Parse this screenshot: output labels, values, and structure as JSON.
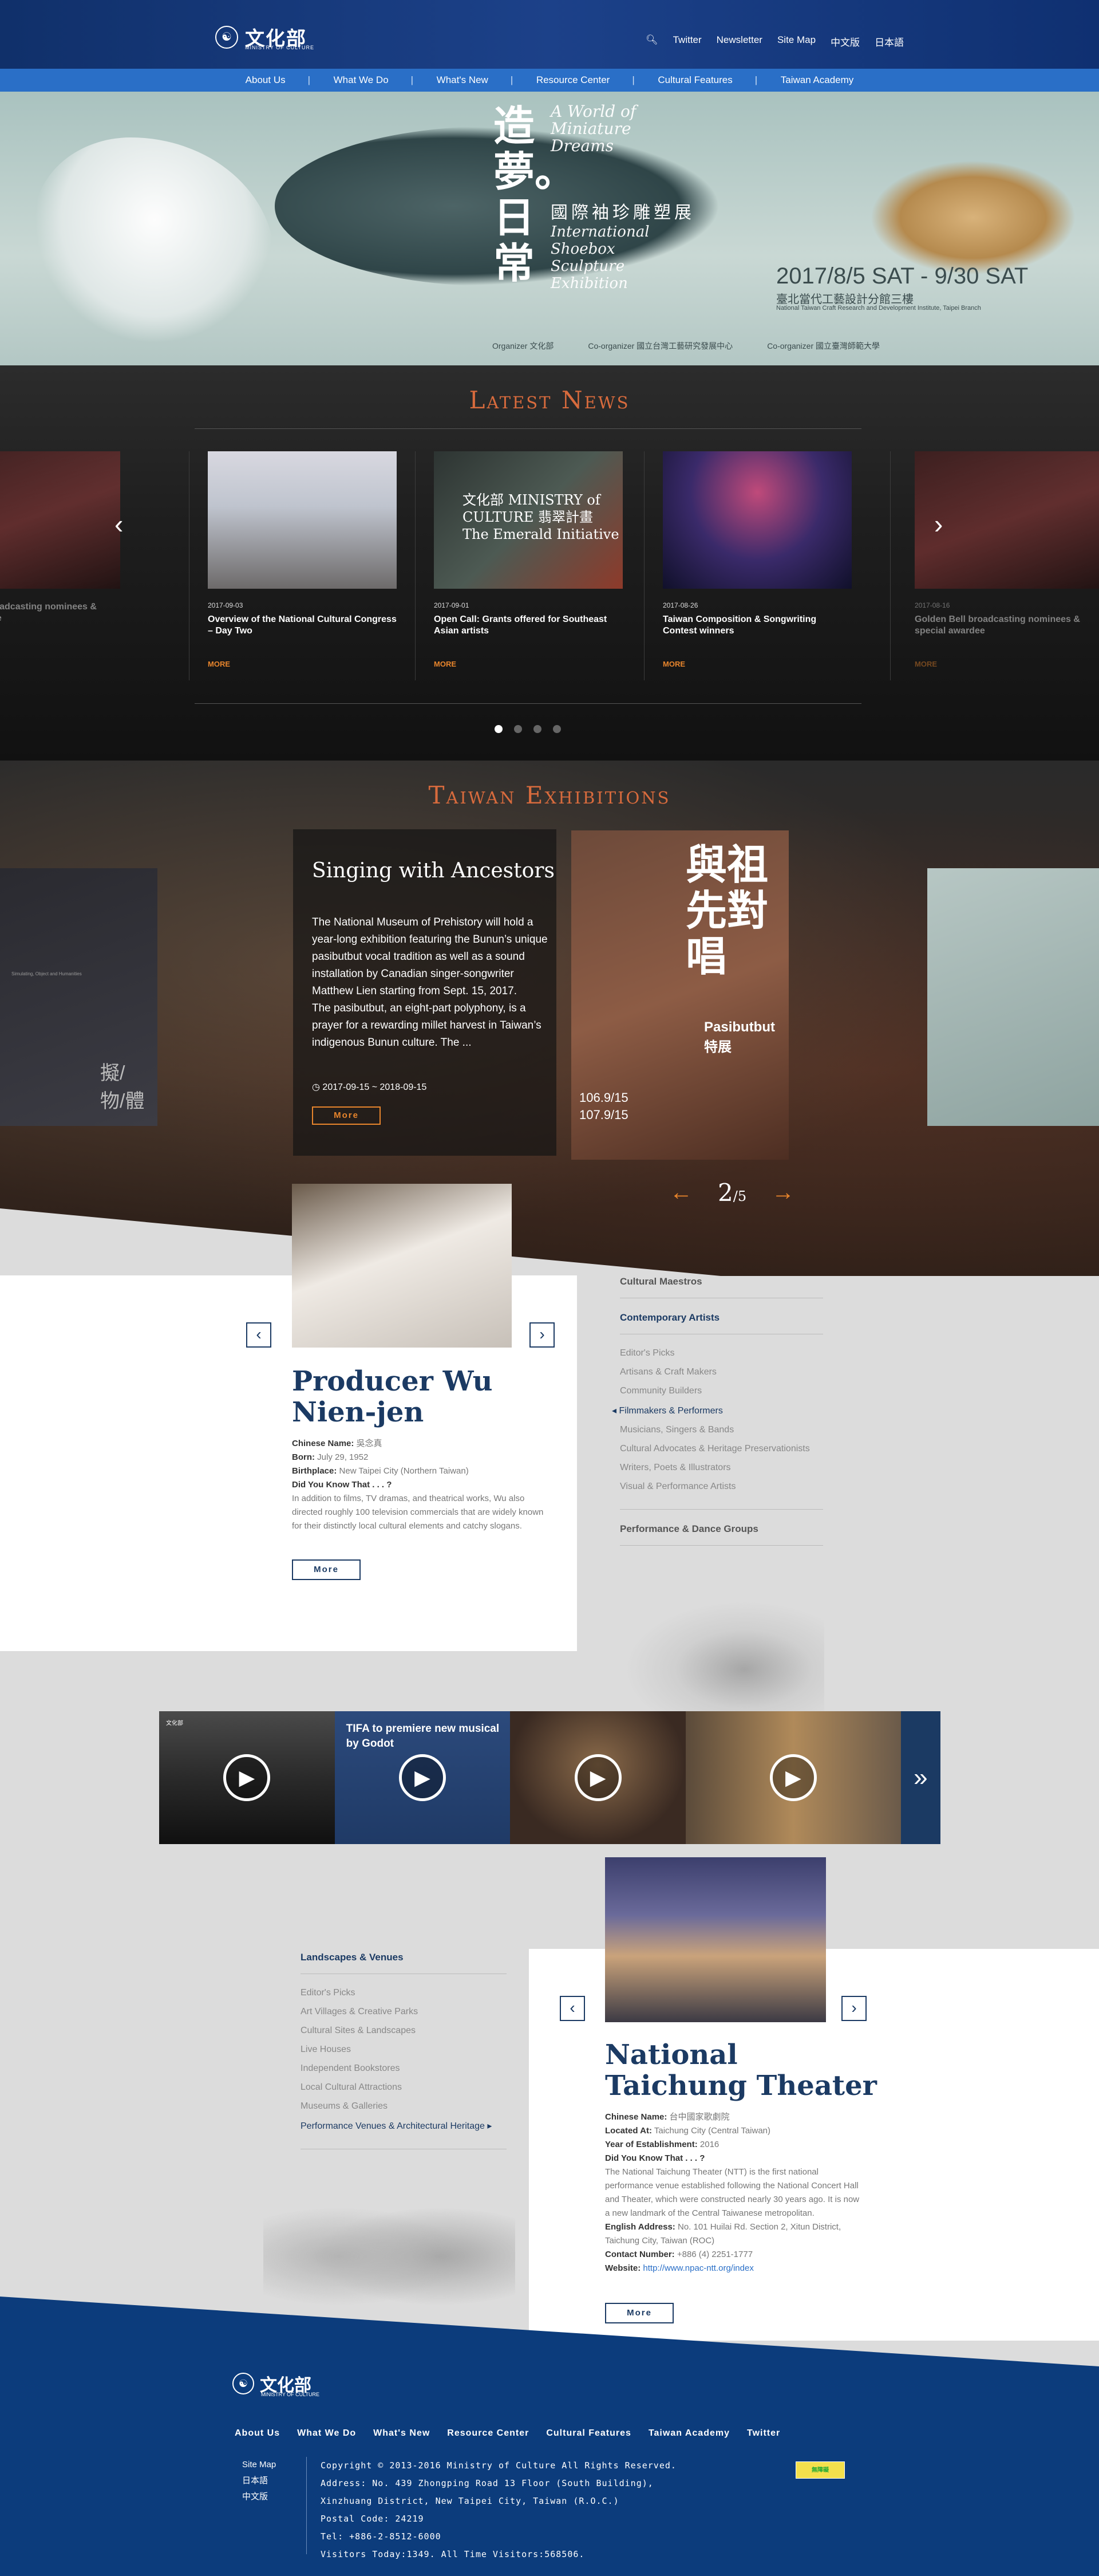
{
  "header": {
    "logo_cn": "文化部",
    "logo_en": "MINISTRY OF CULTURE",
    "top_menu": [
      "Twitter",
      "Newsletter",
      "Site Map",
      "中文版",
      "日本語"
    ],
    "nav": [
      "About Us",
      "What We Do",
      "What's New",
      "Resource Center",
      "Cultural Features",
      "Taiwan Academy"
    ]
  },
  "hero": {
    "title_cn": "造夢。日常",
    "title_en": "A World of Miniature Dreams",
    "subtitle_cn": "國際袖珍雕塑展",
    "subtitle_en": "International Shoebox Sculpture Exhibition",
    "date": "2017/8/5 SAT - 9/30 SAT",
    "venue_cn": "臺北當代工藝設計分館三樓",
    "venue_en": "National Taiwan Craft Research and Development Institute, Taipei Branch",
    "sponsors": [
      "Organizer 文化部",
      "Co-organizer 國立台灣工藝研究發展中心",
      "Co-organizer 國立臺灣師範大學"
    ]
  },
  "news": {
    "title": "Latest News",
    "cards": [
      {
        "date": "",
        "title": "Golden Bell broadcasting nominees & special awardee",
        "more": "MORE"
      },
      {
        "date": "2017-09-03",
        "title": "Overview of the National Cultural Congress – Day Two",
        "more": "MORE"
      },
      {
        "date": "2017-09-01",
        "title": "Open Call: Grants offered for Southeast Asian artists",
        "more": "MORE"
      },
      {
        "date": "2017-08-26",
        "title": "Taiwan Composition & Songwriting Contest winners",
        "more": "MORE"
      },
      {
        "date": "2017-08-16",
        "title": "Golden Bell broadcasting nominees & special awardee",
        "more": "MORE"
      }
    ],
    "card2_img_text": "文化部 MINISTRY of CULTURE 翡翠計畫 The Emerald Initiative",
    "prev": "‹",
    "next": "›",
    "dots": 4,
    "active_dot": 0
  },
  "exhibitions": {
    "title": "Taiwan Exhibitions",
    "item_title": "Singing with Ancestors",
    "body": "The National Museum of Prehistory will hold a year-long exhibition featuring the Bunun’s unique pasibutbut vocal tradition as well as a sound installation by Canadian singer-songwriter Matthew Lien starting from Sept. 15, 2017.\nThe pasibutbut, an eight-part polyphony, is a prayer for a rewarding millet harvest in Taiwan’s indigenous Bunun culture. The ...",
    "date": "2017-09-15 ~ 2018-09-15",
    "more": "More",
    "poster_cn": "與祖先對唱",
    "poster_name": "Pasibutbut 特展",
    "poster_dates": "106.9/15\n107.9/15",
    "side_left_cn": "擬/物/體",
    "side_left_en": "Simulating, Object and Humanities",
    "page_current": "2",
    "page_total": "/5",
    "prev": "←",
    "next": "→"
  },
  "artist": {
    "name": "Producer Wu Nien-jen",
    "chinese_name_label": "Chinese Name:",
    "chinese_name": "吳念真",
    "born_label": "Born:",
    "born": "July 29, 1952",
    "birthplace_label": "Birthplace:",
    "birthplace": "New Taipei City (Northern Taiwan)",
    "dyk_label": "Did You Know That . . . ?",
    "dyk": "In addition to films, TV dramas, and theatrical works, Wu also directed roughly 100 television commercials that are widely known for their distinctly local cultural elements and catchy slogans.",
    "more": "More",
    "prev": "‹",
    "next": "›"
  },
  "artist_categories": {
    "head1": "Cultural Maestros",
    "head2": "Contemporary Artists",
    "items": [
      "Editor's Picks",
      "Artisans & Craft Makers",
      "Community Builders",
      "Filmmakers & Performers",
      "Musicians, Singers & Bands",
      "Cultural Advocates & Heritage Preservationists",
      "Writers, Poets & Illustrators",
      "Visual & Performance Artists"
    ],
    "selected": "Filmmakers & Performers",
    "head3": "Performance & Dance Groups"
  },
  "videos": [
    {
      "title": "",
      "badge": "文化部"
    },
    {
      "title": "TIFA to premiere new musical by Godot"
    },
    {
      "title": ""
    },
    {
      "title": ""
    }
  ],
  "video_next": "»",
  "venue": {
    "name": "National Taichung Theater",
    "chinese_name_label": "Chinese Name:",
    "chinese_name": "台中國家歌劇院",
    "located_label": "Located At:",
    "located": "Taichung City (Central Taiwan)",
    "year_label": "Year of Establishment:",
    "year": "2016",
    "dyk_label": "Did You Know That . . . ?",
    "dyk": "The National Taichung Theater (NTT) is the first national performance venue established following the National Concert Hall and Theater, which were constructed nearly 30 years ago. It is now a new landmark of the Central Taiwanese metropolitan.",
    "address_label": "English Address:",
    "address": "No. 101 Huilai Rd. Section 2, Xitun District, Taichung City, Taiwan (ROC)",
    "contact_label": "Contact Number:",
    "contact": "+886 (4) 2251-1777",
    "website_label": "Website:",
    "website": "http://www.npac-ntt.org/index",
    "more": "More",
    "prev": "‹",
    "next": "›"
  },
  "venue_categories": {
    "head": "Landscapes & Venues",
    "items": [
      "Editor's Picks",
      "Art Villages & Creative Parks",
      "Cultural Sites & Landscapes",
      "Live Houses",
      "Independent Bookstores",
      "Local Cultural Attractions",
      "Museums & Galleries",
      "Performance Venues & Architectural Heritage"
    ],
    "selected": "Performance Venues & Architectural Heritage"
  },
  "footer": {
    "logo_cn": "文化部",
    "logo_en": "MINISTRY OF CULTURE",
    "nav": [
      "About Us",
      "What We Do",
      "What's New",
      "Resource Center",
      "Cultural Features",
      "Taiwan Academy",
      "Twitter"
    ],
    "langs": [
      "Site Map",
      "日本語",
      "中文版"
    ],
    "copyright": "Copyright © 2013-2016 Ministry of Culture All Rights Reserved.",
    "address1": "Address: No. 439 Zhongping Road 13 Floor (South Building),",
    "address2": "Xinzhuang District, New Taipei City, Taiwan (R.O.C.)",
    "postal": "Postal Code: 24219",
    "tel": "Tel: +886-2-8512-6000",
    "visitors": "Visitors Today:1349. All Time Visitors:568506.",
    "badge": "無障礙"
  }
}
